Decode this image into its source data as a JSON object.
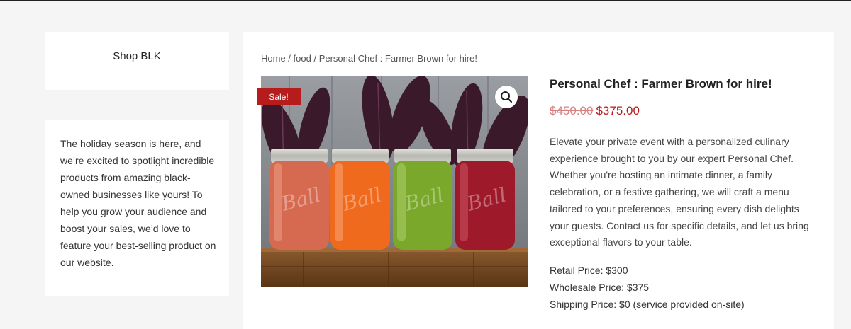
{
  "sidebar": {
    "shop_title": "Shop BLK",
    "promo_text": "The holiday season is here, and we’re excited to spotlight incredible products from amazing black-owned businesses like yours! To help you grow your audience and boost your sales, we’d love to feature your best-selling product on our website."
  },
  "breadcrumb": {
    "home": "Home",
    "sep1": " / ",
    "category": "food",
    "sep2": " / ",
    "current": "Personal Chef : Farmer Brown for hire!"
  },
  "product": {
    "title": "Personal Chef : Farmer Brown for hire!",
    "old_price": "$450.00",
    "new_price": "$375.00",
    "sale_badge": "Sale!",
    "description": "Elevate your private event with a personalized culinary experience brought to you by our expert Personal Chef. Whether you're hosting an intimate dinner, a family celebration, or a festive gathering, we will craft a menu tailored to your preferences, ensuring every dish delights your guests. Contact us for specific details, and let us bring exceptional flavors to your table.",
    "retail_price": "Retail Price: $300",
    "wholesale_price": "Wholesale Price: $375",
    "shipping_price": "Shipping Price: $0 (service provided on-site)"
  },
  "icons": {
    "zoom": "magnifier-icon"
  },
  "colors": {
    "accent": "#b71c1c",
    "background": "#f5f5f5"
  },
  "image": {
    "jar_labels": [
      "Ball",
      "Ball",
      "Ball",
      "Ball"
    ]
  }
}
